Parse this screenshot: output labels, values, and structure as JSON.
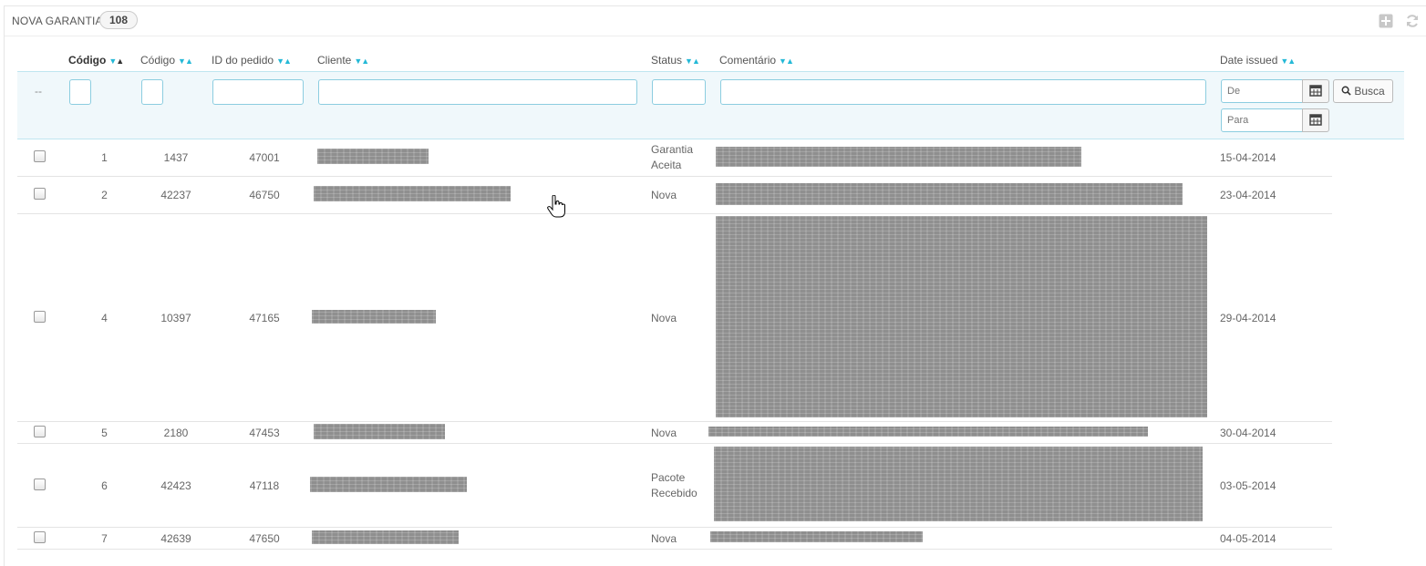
{
  "panel": {
    "title": "NOVA GARANTIA",
    "count": "108",
    "tools": [
      "add-icon",
      "refresh-icon"
    ]
  },
  "columns": [
    {
      "label": "Código",
      "active": true
    },
    {
      "label": "Código"
    },
    {
      "label": "ID do pedido"
    },
    {
      "label": "Cliente"
    },
    {
      "label": "Status"
    },
    {
      "label": "Comentário"
    },
    {
      "label": "Date issued"
    }
  ],
  "filters": {
    "bulk_placeholder": "--",
    "date_from_placeholder": "De",
    "date_to_placeholder": "Para",
    "search_label": "Busca"
  },
  "rows": [
    {
      "id": "1",
      "code": "1437",
      "order": "47001",
      "status": "Garantia Aceita",
      "date": "15-04-2014"
    },
    {
      "id": "2",
      "code": "42237",
      "order": "46750",
      "status": "Nova",
      "date": "23-04-2014"
    },
    {
      "id": "4",
      "code": "10397",
      "order": "47165",
      "status": "Nova",
      "date": "29-04-2014"
    },
    {
      "id": "5",
      "code": "2180",
      "order": "47453",
      "status": "Nova",
      "date": "30-04-2014"
    },
    {
      "id": "6",
      "code": "42423",
      "order": "47118",
      "status": "Pacote Recebido",
      "date": "03-05-2014"
    },
    {
      "id": "7",
      "code": "42639",
      "order": "47650",
      "status": "Nova",
      "date": "04-05-2014"
    }
  ],
  "colors": {
    "accent": "#25b9d7",
    "filter_bg": "#f0f8fb",
    "redaction": "#8f8f8f"
  }
}
